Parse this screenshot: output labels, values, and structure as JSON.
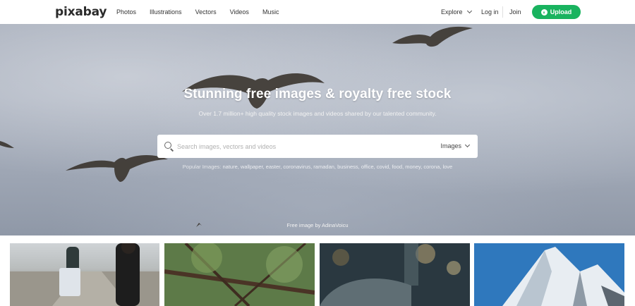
{
  "header": {
    "logo": "pixabay",
    "nav": [
      "Photos",
      "Illustrations",
      "Vectors",
      "Videos",
      "Music"
    ],
    "explore_label": "Explore",
    "login_label": "Log in",
    "join_label": "Join",
    "upload_label": "Upload",
    "accent": "#19b35f"
  },
  "hero": {
    "title": "Stunning free images & royalty free stock",
    "subtitle": "Over 1.7 million+ high quality stock images and videos shared by our talented community.",
    "search_placeholder": "Search images, vectors and videos",
    "search_value": "",
    "type_selected": "Images",
    "popular_label": "Popular Images:",
    "popular_tags": "nature, wallpaper, easter, coronavirus, ramadan, business, office, covid, food, money, corona, love",
    "credit": "Free image by AdinaVoicu"
  },
  "thumbnails": [
    {
      "subject": "couple-walking-road"
    },
    {
      "subject": "tree-branches"
    },
    {
      "subject": "city-bokeh-umbrella"
    },
    {
      "subject": "snowy-mountain"
    }
  ]
}
